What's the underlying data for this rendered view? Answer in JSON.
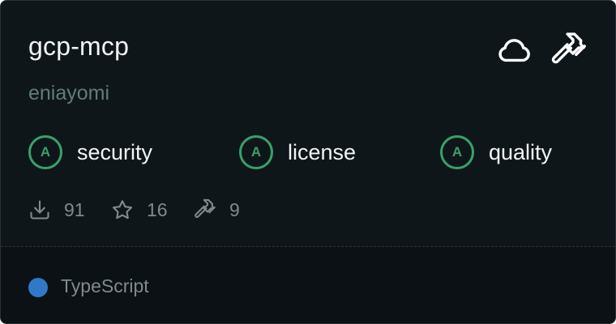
{
  "server": {
    "name": "gcp-mcp",
    "author": "eniayomi"
  },
  "header_icons": [
    "cloud-icon",
    "hammer-icon"
  ],
  "grades": [
    {
      "grade": "A",
      "label": "security"
    },
    {
      "grade": "A",
      "label": "license"
    },
    {
      "grade": "A",
      "label": "quality"
    }
  ],
  "stats": {
    "downloads": "91",
    "stars": "16",
    "tools": "9"
  },
  "language": {
    "name": "TypeScript",
    "color": "#3178c6"
  },
  "colors": {
    "grade_accent": "#38a16a",
    "background": "#0f1619"
  }
}
